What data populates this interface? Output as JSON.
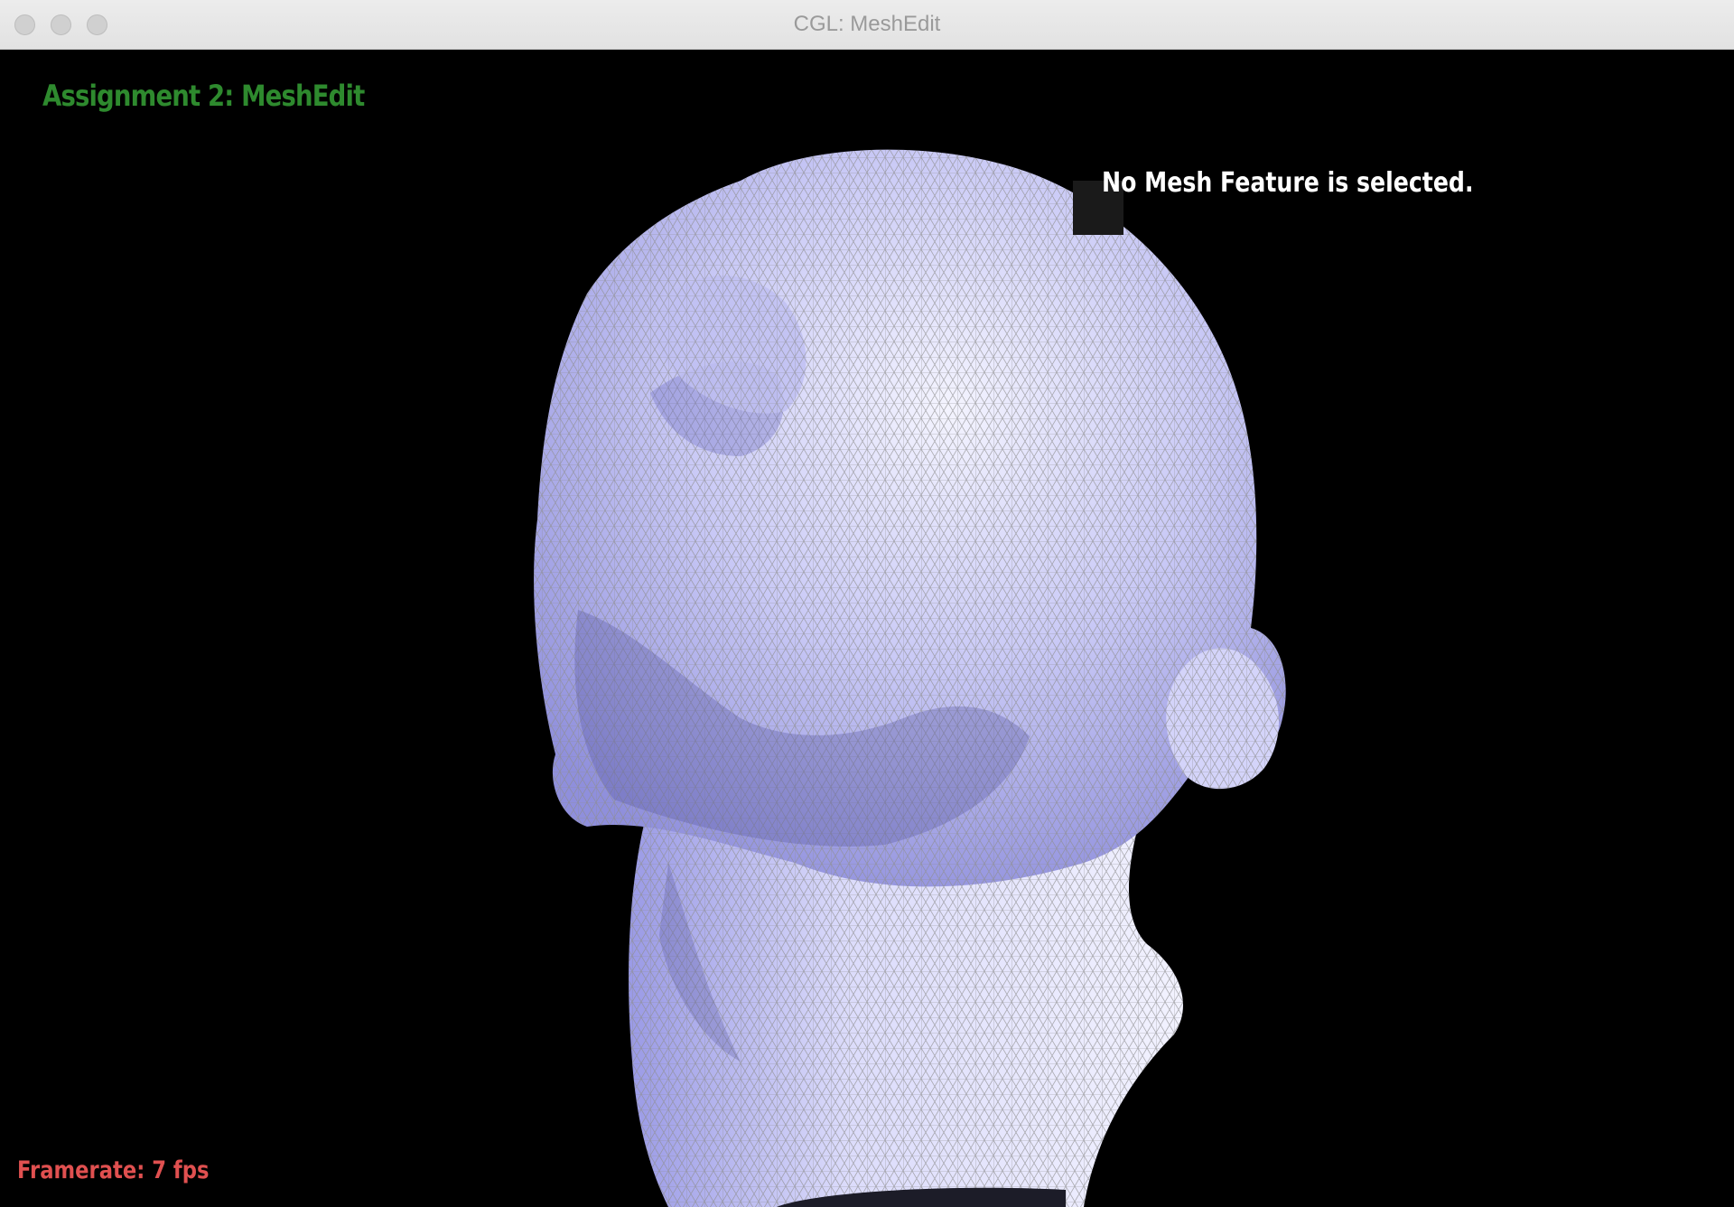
{
  "window": {
    "title": "CGL: MeshEdit"
  },
  "hud": {
    "title": "Assignment 2: MeshEdit",
    "status": "No Mesh Feature is selected.",
    "framerate": "Framerate: 7 fps"
  },
  "colors": {
    "title_text": "#2e8a2e",
    "status_text": "#ffffff",
    "framerate_text": "#e05050",
    "mesh_face": "#b7b7f4",
    "mesh_wire": "#9a9a9a",
    "background": "#000000"
  }
}
